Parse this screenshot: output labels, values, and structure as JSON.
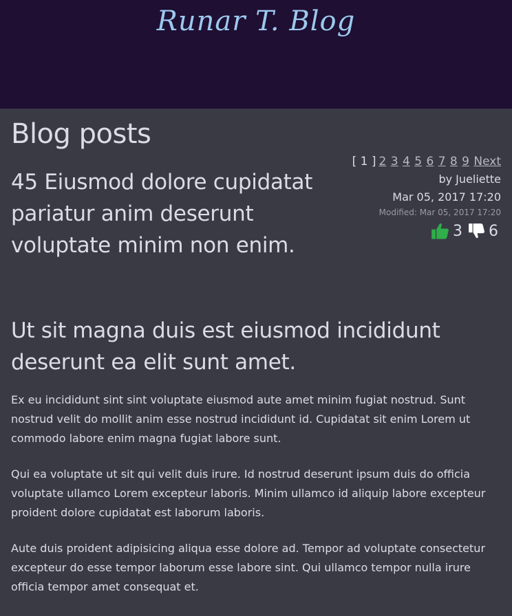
{
  "site": {
    "title": "Runar T. Blog"
  },
  "page": {
    "title": "Blog posts"
  },
  "pagination": {
    "current": "[ 1 ]",
    "pages": [
      "2",
      "3",
      "4",
      "5",
      "6",
      "7",
      "8",
      "9"
    ],
    "next": "Next"
  },
  "post": {
    "title": "45 Eiusmod dolore cupidatat pariatur anim deserunt voluptate minim non enim.",
    "author": "by Jueliette",
    "date": "Mar 05, 2017 17:20",
    "modified": "Modified: Mar 05, 2017 17:20",
    "likes": "3",
    "dislikes": "6",
    "subtitle": "Ut sit magna duis est eiusmod incididunt deserunt ea elit sunt amet.",
    "paragraphs": [
      "Ex eu incididunt sint sint voluptate eiusmod aute amet minim fugiat nostrud. Sunt nostrud velit do mollit anim esse nostrud incididunt id. Cupidatat sit enim Lorem ut commodo labore enim magna fugiat labore sunt.",
      "Qui ea voluptate ut sit qui velit duis irure. Id nostrud deserunt ipsum duis do officia voluptate ullamco Lorem excepteur laboris. Minim ullamco id aliquip labore excepteur proident dolore cupidatat est laborum laboris.",
      "Aute duis proident adipisicing aliqua esse dolore ad. Tempor ad voluptate consectetur excepteur do esse tempor laborum esse labore sint. Qui ullamco tempor nulla irure officia tempor amet consequat et."
    ]
  },
  "colors": {
    "header_bg": "#1f0f33",
    "page_bg": "#3a3a44",
    "site_title": "#9cc9ee",
    "like_icon": "#2fae4a",
    "dislike_icon": "#ffffff"
  },
  "icons": {
    "like": "thumbs-up-icon",
    "dislike": "thumbs-down-icon"
  }
}
